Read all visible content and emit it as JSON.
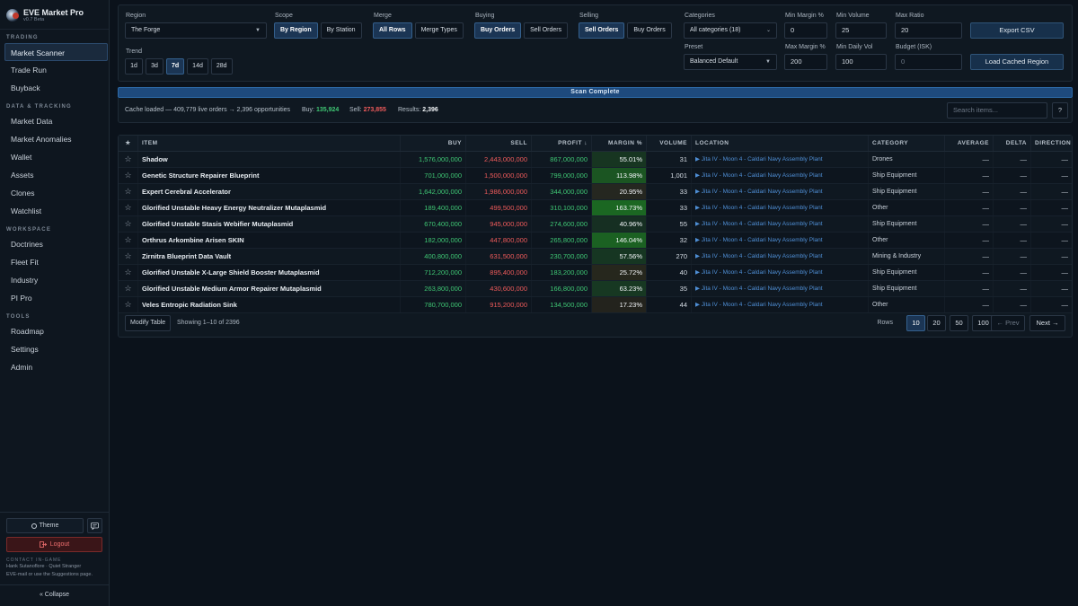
{
  "app": {
    "title": "EVE Market Pro",
    "version": "v0.7 Beta"
  },
  "sidebar": {
    "sections": [
      {
        "title": "TRADING",
        "items": [
          "Market Scanner",
          "Trade Run",
          "Buyback"
        ]
      },
      {
        "title": "DATA & TRACKING",
        "items": [
          "Market Data",
          "Market Anomalies",
          "Wallet",
          "Assets",
          "Clones",
          "Watchlist"
        ]
      },
      {
        "title": "WORKSPACE",
        "items": [
          "Doctrines",
          "Fleet Fit",
          "Industry",
          "PI Pro"
        ]
      },
      {
        "title": "TOOLS",
        "items": [
          "Roadmap",
          "Settings",
          "Admin"
        ]
      }
    ],
    "active": "Market Scanner",
    "theme_label": "Theme",
    "logout_label": "Logout",
    "contact_title": "CONTACT IN-GAME",
    "contact_line1": "Hank Sutanoflore · Quiet Stranger",
    "contact_line2": "EVE-mail or use the Suggestions page.",
    "collapse_label": "« Collapse"
  },
  "filters": {
    "region_label": "Region",
    "region_value": "The Forge",
    "trend_label": "Trend",
    "trend_options": [
      "1d",
      "3d",
      "7d",
      "14d",
      "28d"
    ],
    "trend_selected": "7d",
    "scope_label": "Scope",
    "scope_options": [
      "By Region",
      "By Station"
    ],
    "scope_selected": "By Region",
    "merge_label": "Merge",
    "merge_options": [
      "All Rows",
      "Merge Types"
    ],
    "merge_selected": "All Rows",
    "buying_label": "Buying",
    "buying_options": [
      "Buy Orders",
      "Sell Orders"
    ],
    "buying_selected": "Buy Orders",
    "selling_label": "Selling",
    "selling_options": [
      "Sell Orders",
      "Buy Orders"
    ],
    "selling_selected": "Sell Orders",
    "categories_label": "Categories",
    "categories_value": "All categories (18)",
    "preset_label": "Preset",
    "preset_value": "Balanced Default",
    "min_margin_label": "Min Margin %",
    "min_margin_value": "0",
    "max_margin_label": "Max Margin %",
    "max_margin_value": "200",
    "min_volume_label": "Min Volume",
    "min_volume_value": "25",
    "min_daily_vol_label": "Min Daily Vol",
    "min_daily_vol_value": "100",
    "max_ratio_label": "Max Ratio",
    "max_ratio_value": "20",
    "budget_label": "Budget (ISK)",
    "budget_placeholder": "0",
    "export_label": "Export CSV",
    "load_label": "Load Cached Region"
  },
  "scan": {
    "banner": "Scan Complete",
    "cache_text": "Cache loaded — 409,779 live orders → 2,396 opportunities",
    "buy_label": "Buy:",
    "buy_count": "135,924",
    "sell_label": "Sell:",
    "sell_count": "273,855",
    "results_label": "Results:",
    "results_count": "2,396",
    "search_placeholder": "Search items...",
    "help_label": "?"
  },
  "table": {
    "headers": {
      "star": "★",
      "item": "ITEM",
      "buy": "BUY",
      "sell": "SELL",
      "profit": "PROFIT ↓",
      "margin": "MARGIN %",
      "volume": "VOLUME",
      "location": "LOCATION",
      "category": "CATEGORY",
      "average": "AVERAGE",
      "delta": "DELTA",
      "direction": "DIRECTION"
    },
    "rows": [
      {
        "star": "☆",
        "item": "Shadow",
        "buy": "1,576,000,000",
        "sell": "2,443,000,000",
        "profit": "867,000,000",
        "margin": "55.01%",
        "margin_value": 55.01,
        "volume": "31",
        "location": "▶ Jita IV - Moon 4 - Caldari Navy Assembly Plant",
        "category": "Drones",
        "average": "—",
        "delta": "—",
        "direction": "—"
      },
      {
        "star": "☆",
        "item": "Genetic Structure Repairer Blueprint",
        "buy": "701,000,000",
        "sell": "1,500,000,000",
        "profit": "799,000,000",
        "margin": "113.98%",
        "margin_value": 113.98,
        "volume": "1,001",
        "location": "▶ Jita IV - Moon 4 - Caldari Navy Assembly Plant",
        "category": "Ship Equipment",
        "average": "—",
        "delta": "—",
        "direction": "—"
      },
      {
        "star": "☆",
        "item": "Expert Cerebral Accelerator",
        "buy": "1,642,000,000",
        "sell": "1,986,000,000",
        "profit": "344,000,000",
        "margin": "20.95%",
        "margin_value": 20.95,
        "volume": "33",
        "location": "▶ Jita IV - Moon 4 - Caldari Navy Assembly Plant",
        "category": "Ship Equipment",
        "average": "—",
        "delta": "—",
        "direction": "—"
      },
      {
        "star": "☆",
        "item": "Glorified Unstable Heavy Energy Neutralizer Mutaplasmid",
        "buy": "189,400,000",
        "sell": "499,500,000",
        "profit": "310,100,000",
        "margin": "163.73%",
        "margin_value": 163.73,
        "volume": "33",
        "location": "▶ Jita IV - Moon 4 - Caldari Navy Assembly Plant",
        "category": "Other",
        "average": "—",
        "delta": "—",
        "direction": "—"
      },
      {
        "star": "☆",
        "item": "Glorified Unstable Stasis Webifier Mutaplasmid",
        "buy": "670,400,000",
        "sell": "945,000,000",
        "profit": "274,600,000",
        "margin": "40.96%",
        "margin_value": 40.96,
        "volume": "55",
        "location": "▶ Jita IV - Moon 4 - Caldari Navy Assembly Plant",
        "category": "Ship Equipment",
        "average": "—",
        "delta": "—",
        "direction": "—"
      },
      {
        "star": "☆",
        "item": "Orthrus Arkombine Arisen SKIN",
        "buy": "182,000,000",
        "sell": "447,800,000",
        "profit": "265,800,000",
        "margin": "146.04%",
        "margin_value": 146.04,
        "volume": "32",
        "location": "▶ Jita IV - Moon 4 - Caldari Navy Assembly Plant",
        "category": "Other",
        "average": "—",
        "delta": "—",
        "direction": "—"
      },
      {
        "star": "☆",
        "item": "Zirnitra Blueprint Data Vault",
        "buy": "400,800,000",
        "sell": "631,500,000",
        "profit": "230,700,000",
        "margin": "57.56%",
        "margin_value": 57.56,
        "volume": "270",
        "location": "▶ Jita IV - Moon 4 - Caldari Navy Assembly Plant",
        "category": "Mining & Industry",
        "average": "—",
        "delta": "—",
        "direction": "—"
      },
      {
        "star": "☆",
        "item": "Glorified Unstable X-Large Shield Booster Mutaplasmid",
        "buy": "712,200,000",
        "sell": "895,400,000",
        "profit": "183,200,000",
        "margin": "25.72%",
        "margin_value": 25.72,
        "volume": "40",
        "location": "▶ Jita IV - Moon 4 - Caldari Navy Assembly Plant",
        "category": "Ship Equipment",
        "average": "—",
        "delta": "—",
        "direction": "—"
      },
      {
        "star": "☆",
        "item": "Glorified Unstable Medium Armor Repairer Mutaplasmid",
        "buy": "263,800,000",
        "sell": "430,600,000",
        "profit": "166,800,000",
        "margin": "63.23%",
        "margin_value": 63.23,
        "volume": "35",
        "location": "▶ Jita IV - Moon 4 - Caldari Navy Assembly Plant",
        "category": "Ship Equipment",
        "average": "—",
        "delta": "—",
        "direction": "—"
      },
      {
        "star": "☆",
        "item": "Veles Entropic Radiation Sink",
        "buy": "780,700,000",
        "sell": "915,200,000",
        "profit": "134,500,000",
        "margin": "17.23%",
        "margin_value": 17.23,
        "volume": "44",
        "location": "▶ Jita IV - Moon 4 - Caldari Navy Assembly Plant",
        "category": "Other",
        "average": "—",
        "delta": "—",
        "direction": "—"
      }
    ],
    "modify_label": "Modify Table",
    "showing": "Showing 1–10 of 2396",
    "rows_label": "Rows",
    "page_sizes": [
      "10",
      "20",
      "50",
      "100"
    ],
    "page_size_selected": "10",
    "prev_label": "← Prev",
    "next_label": "Next →"
  },
  "colors": {
    "accent": "#1b3554",
    "buy": "#3fc774",
    "sell": "#ef5b5b",
    "location": "#4f8fd6",
    "danger": "#f07070"
  }
}
